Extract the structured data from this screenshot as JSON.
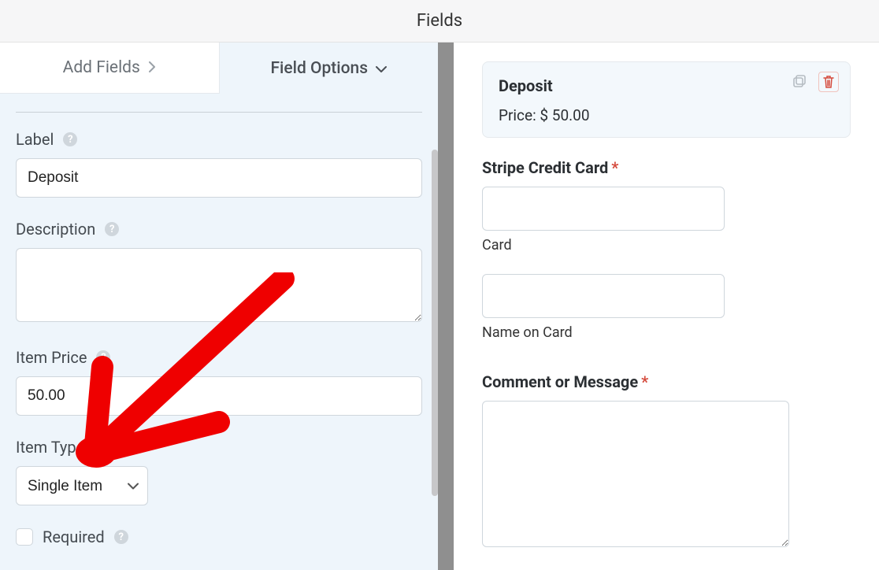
{
  "header": {
    "title": "Fields"
  },
  "tabs": {
    "add": "Add Fields",
    "options": "Field Options"
  },
  "options": {
    "labelLabel": "Label",
    "labelValue": "Deposit",
    "descriptionLabel": "Description",
    "descriptionValue": "",
    "itemPriceLabel": "Item Price",
    "itemPriceValue": "50.00",
    "itemTypeLabel": "Item Type",
    "itemTypeSelected": "Single Item",
    "requiredLabel": "Required"
  },
  "preview": {
    "depositTitle": "Deposit",
    "depositPrice": "Price: $ 50.00",
    "stripeLabel": "Stripe Credit Card",
    "cardSub": "Card",
    "nameSub": "Name on Card",
    "commentLabel": "Comment or Message"
  }
}
